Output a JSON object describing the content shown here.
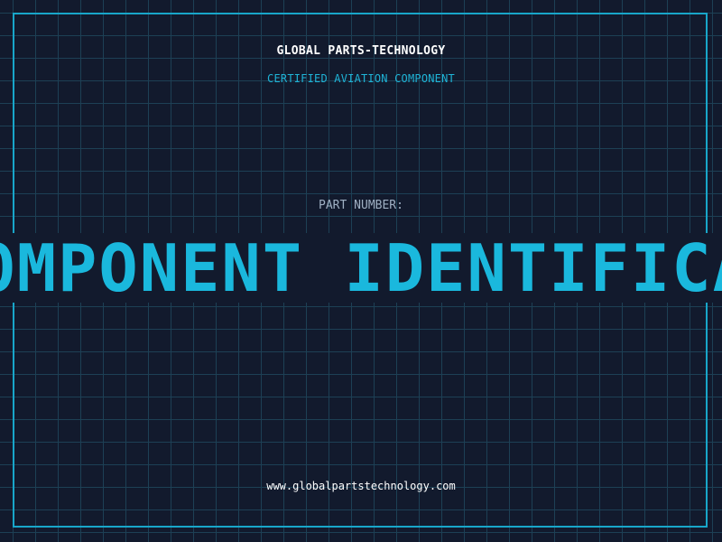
{
  "header": {
    "company": "GLOBAL PARTS-TECHNOLOGY",
    "certification": "CERTIFIED AVIATION COMPONENT"
  },
  "part": {
    "label": "PART NUMBER:",
    "banner_text": "COMPONENT IDENTIFICATION"
  },
  "footer": {
    "website": "www.globalpartstechnology.com"
  },
  "colors": {
    "background": "#121a2d",
    "grid": "#1d4055",
    "accent": "#1ab8dd",
    "label": "#9fb0c3"
  }
}
